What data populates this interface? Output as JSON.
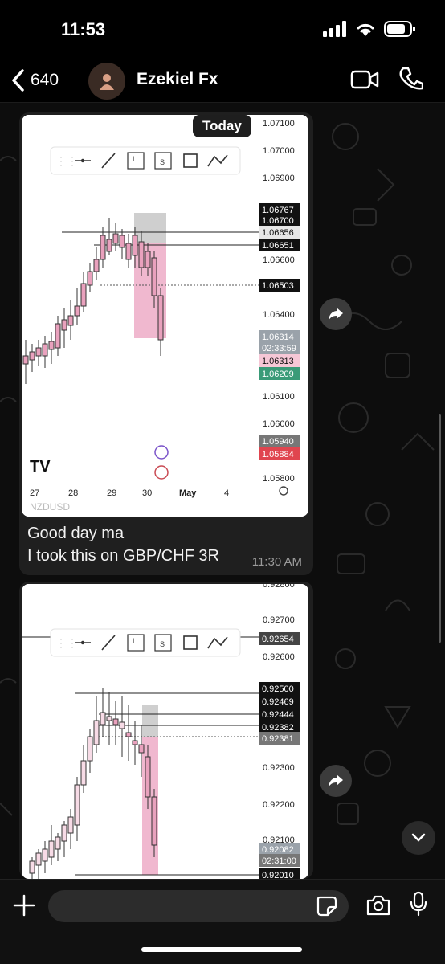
{
  "status_bar": {
    "time": "11:53",
    "icons": [
      "signal-bars-icon",
      "wifi-icon",
      "battery-icon"
    ]
  },
  "header": {
    "back_count": "640",
    "contact_name": "Ezekiel Fx",
    "icons": [
      "back-chevron-icon",
      "person-avatar-icon",
      "video-call-icon",
      "phone-icon"
    ]
  },
  "date_pill": "Today",
  "messages": [
    {
      "type": "image",
      "caption_lines": [
        "Good day ma",
        "I took this on GBP/CHF 3R"
      ],
      "time": "11:30 AM"
    }
  ],
  "chart1": {
    "price_labels": [
      "1.07100",
      "1.07000",
      "1.06900",
      "1.06600",
      "1.06400",
      "1.06100",
      "1.06000",
      "1.05800"
    ],
    "tags": [
      "1.06767",
      "1.06700",
      "1.06656",
      "1.06651",
      "1.06503",
      "1.06314",
      "02:33:59",
      "1.06313",
      "1.06209",
      "1.05940",
      "1.05884"
    ],
    "date_labels": [
      "27",
      "28",
      "29",
      "30",
      "May",
      "4"
    ],
    "toolbar_letters": [
      "L",
      "S"
    ],
    "symbol": "NZDUSD"
  },
  "chart2": {
    "price_labels": [
      "0.92800",
      "0.92700",
      "0.92600",
      "0.92300",
      "0.92200",
      "0.92100"
    ],
    "tags": [
      "0.92654",
      "0.92500",
      "0.92469",
      "0.92444",
      "0.92382",
      "0.92381",
      "0.92082",
      "02:31:00",
      "0.92010"
    ],
    "toolbar_letters": [
      "L",
      "S"
    ]
  },
  "composer": {
    "placeholder": ""
  },
  "colors": {
    "accent_pink": "#f0b8cf",
    "green_tag": "#3a9b78",
    "red_tag": "#e0454f",
    "bubble": "#1f1f1f"
  }
}
